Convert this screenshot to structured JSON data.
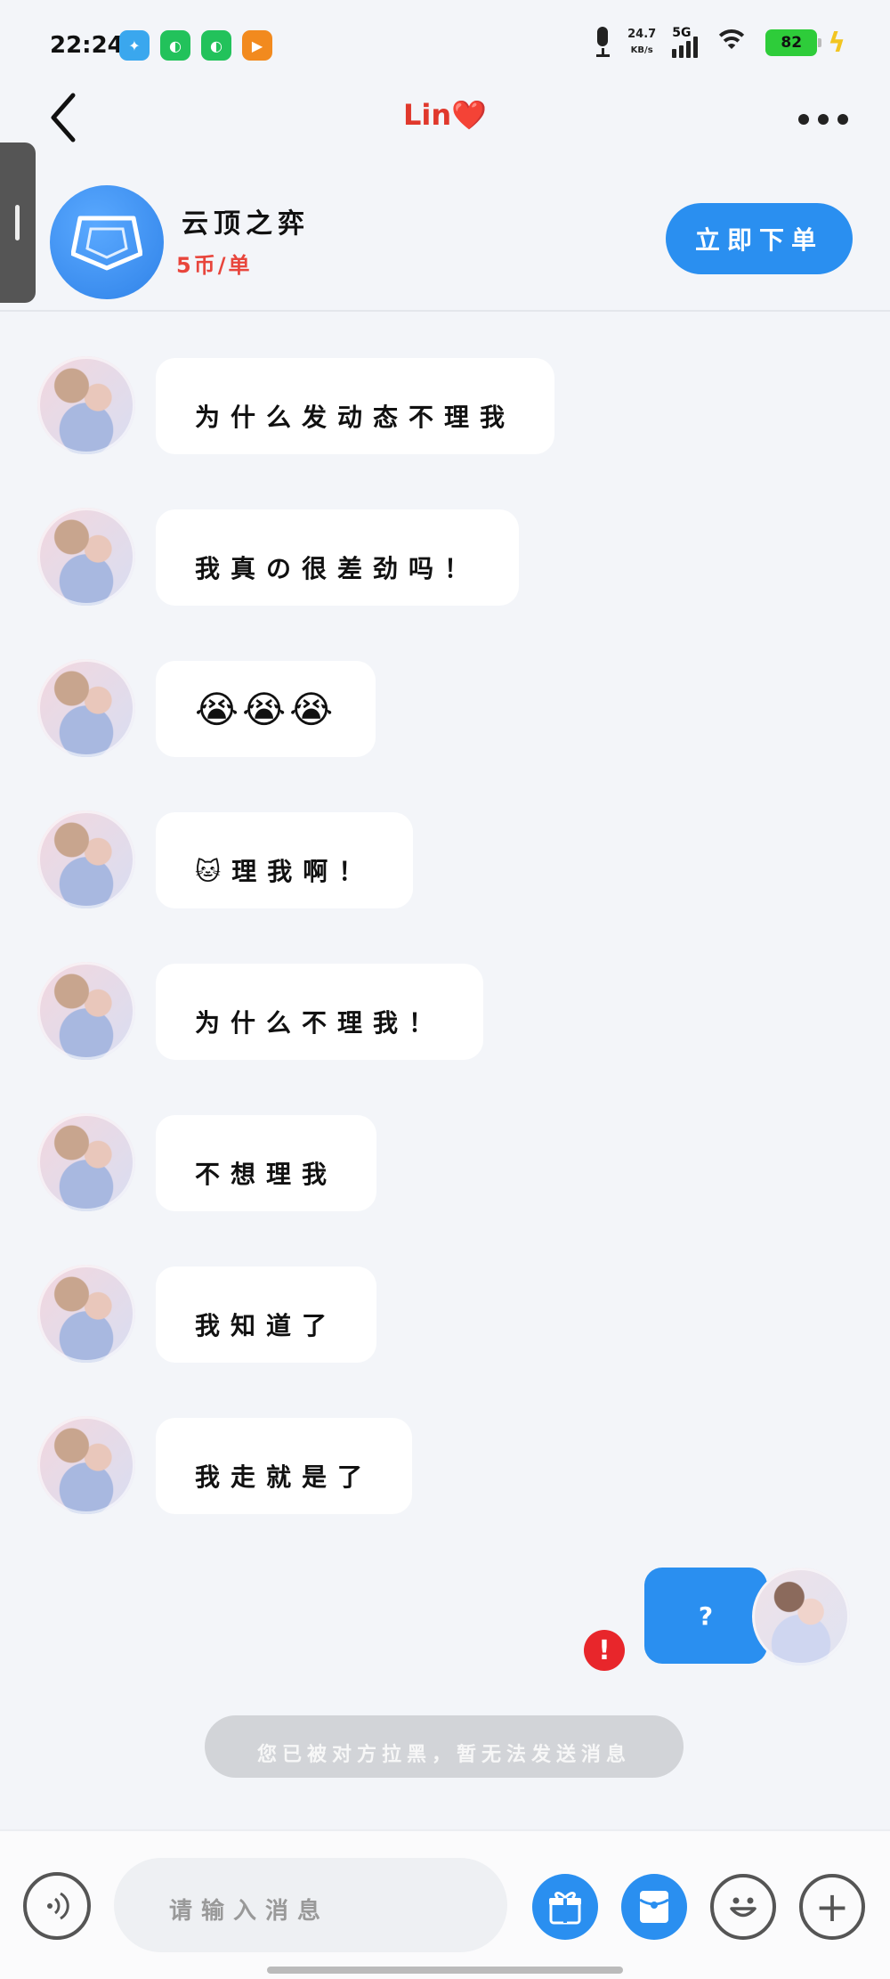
{
  "status_bar": {
    "time": "22:24",
    "network_speed": "24.7",
    "network_speed_unit": "KB/s",
    "network_type": "5G",
    "battery": "82",
    "app_icons": [
      "bird-app-icon",
      "wechat-icon",
      "wechat-icon",
      "video-app-icon"
    ]
  },
  "header": {
    "title": "Lin❤️"
  },
  "service": {
    "name": "云顶之弈",
    "price": "5币/单",
    "order_button": "立即下单"
  },
  "messages": [
    {
      "type": "received",
      "text": "为什么发动态不理我"
    },
    {
      "type": "received",
      "text": "我真の很差劲吗！"
    },
    {
      "type": "received",
      "text": "😭😭😭"
    },
    {
      "type": "received",
      "text": "🐱理我啊！"
    },
    {
      "type": "received",
      "text": "为什么不理我！"
    },
    {
      "type": "received",
      "text": "不想理我"
    },
    {
      "type": "received",
      "text": "我知道了"
    },
    {
      "type": "received",
      "text": "我走就是了"
    }
  ],
  "sent_message": {
    "text": "?",
    "error_icon": "!"
  },
  "system_notice": "您已被对方拉黑，暂无法发送消息",
  "input_bar": {
    "placeholder": "请输入消息",
    "plus": "+"
  },
  "colors": {
    "accent": "#2a8ff0",
    "title_red": "#e0382c",
    "price_red": "#e8453c",
    "error_red": "#e8262b",
    "background": "#f3f5f9"
  }
}
